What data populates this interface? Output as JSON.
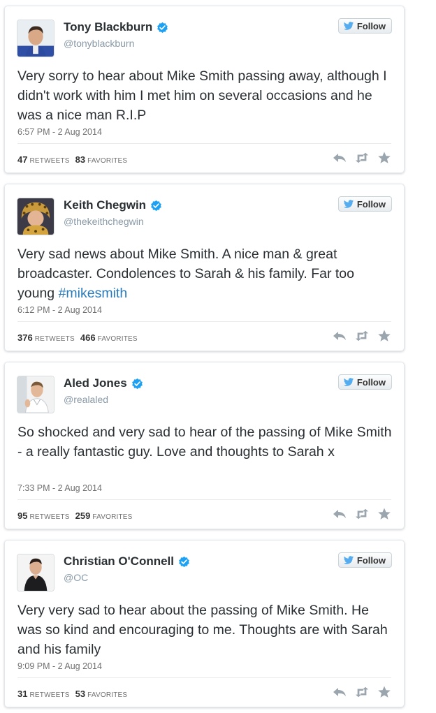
{
  "follow_label": "Follow",
  "colors": {
    "verified": "#1da1f2",
    "hashtag": "#2b7bb9",
    "twitter_bird": "#55acee"
  },
  "tweets": [
    {
      "name": "Tony Blackburn",
      "handle": "@tonyblackburn",
      "text_before": "Very sorry to hear about Mike Smith passing away, although I didn't work with him I met him on several occasions and he was a nice man R.I.P",
      "hashtag": "",
      "timestamp": "6:57 PM - 2 Aug 2014",
      "retweets": "47",
      "retweets_label": "RETWEETS",
      "favorites": "83",
      "favorites_label": "FAVORITES",
      "avatar_icon": "avatar-tony-blackburn"
    },
    {
      "name": "Keith Chegwin",
      "handle": "@thekeithchegwin",
      "text_before": "Very sad news about Mike Smith. A nice man & great broadcaster. Condolences to Sarah & his family. Far too young ",
      "hashtag": "#mikesmith",
      "timestamp": "6:12 PM - 2 Aug 2014",
      "retweets": "376",
      "retweets_label": "RETWEETS",
      "favorites": "466",
      "favorites_label": "FAVORITES",
      "avatar_icon": "avatar-keith-chegwin"
    },
    {
      "name": "Aled Jones",
      "handle": "@realaled",
      "text_before": "So shocked and very sad to hear of the passing of Mike Smith - a really fantastic guy.  Love and thoughts to Sarah x",
      "hashtag": "",
      "timestamp": "7:33 PM - 2 Aug 2014",
      "retweets": "95",
      "retweets_label": "RETWEETS",
      "favorites": "259",
      "favorites_label": "FAVORITES",
      "avatar_icon": "avatar-aled-jones"
    },
    {
      "name": "Christian O'Connell",
      "handle": "@OC",
      "text_before": "Very very sad to hear about the passing of Mike Smith. He was so kind and encouraging to me. Thoughts are with Sarah and his family",
      "hashtag": "",
      "timestamp": "9:09 PM - 2 Aug 2014",
      "retweets": "31",
      "retweets_label": "RETWEETS",
      "favorites": "53",
      "favorites_label": "FAVORITES",
      "avatar_icon": "avatar-christian-oconnell"
    }
  ]
}
